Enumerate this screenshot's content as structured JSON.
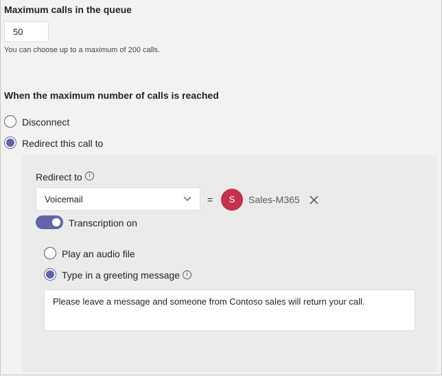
{
  "queue": {
    "title": "Maximum calls in the queue",
    "value": "50",
    "help": "You can choose up to a maximum of 200 calls."
  },
  "max_reached": {
    "title": "When the maximum number of calls is reached",
    "options": [
      {
        "label": "Disconnect",
        "checked": false
      },
      {
        "label": "Redirect this call to",
        "checked": true
      }
    ]
  },
  "redirect": {
    "label": "Redirect to",
    "info_glyph": "i",
    "dropdown_value": "Voicemail",
    "equals": "=",
    "target": {
      "initial": "S",
      "name": "Sales-M365",
      "color": "#c4314b"
    },
    "transcription_label": "Transcription on",
    "transcription_on": true,
    "greeting_options": [
      {
        "label": "Play an audio file",
        "checked": false
      },
      {
        "label": "Type in a greeting message",
        "checked": true
      }
    ],
    "greeting_text": "Please leave a message and someone from Contoso sales will return your call."
  },
  "colors": {
    "accent": "#6264a7",
    "avatar": "#c4314b",
    "background": "#f3f2f1"
  }
}
